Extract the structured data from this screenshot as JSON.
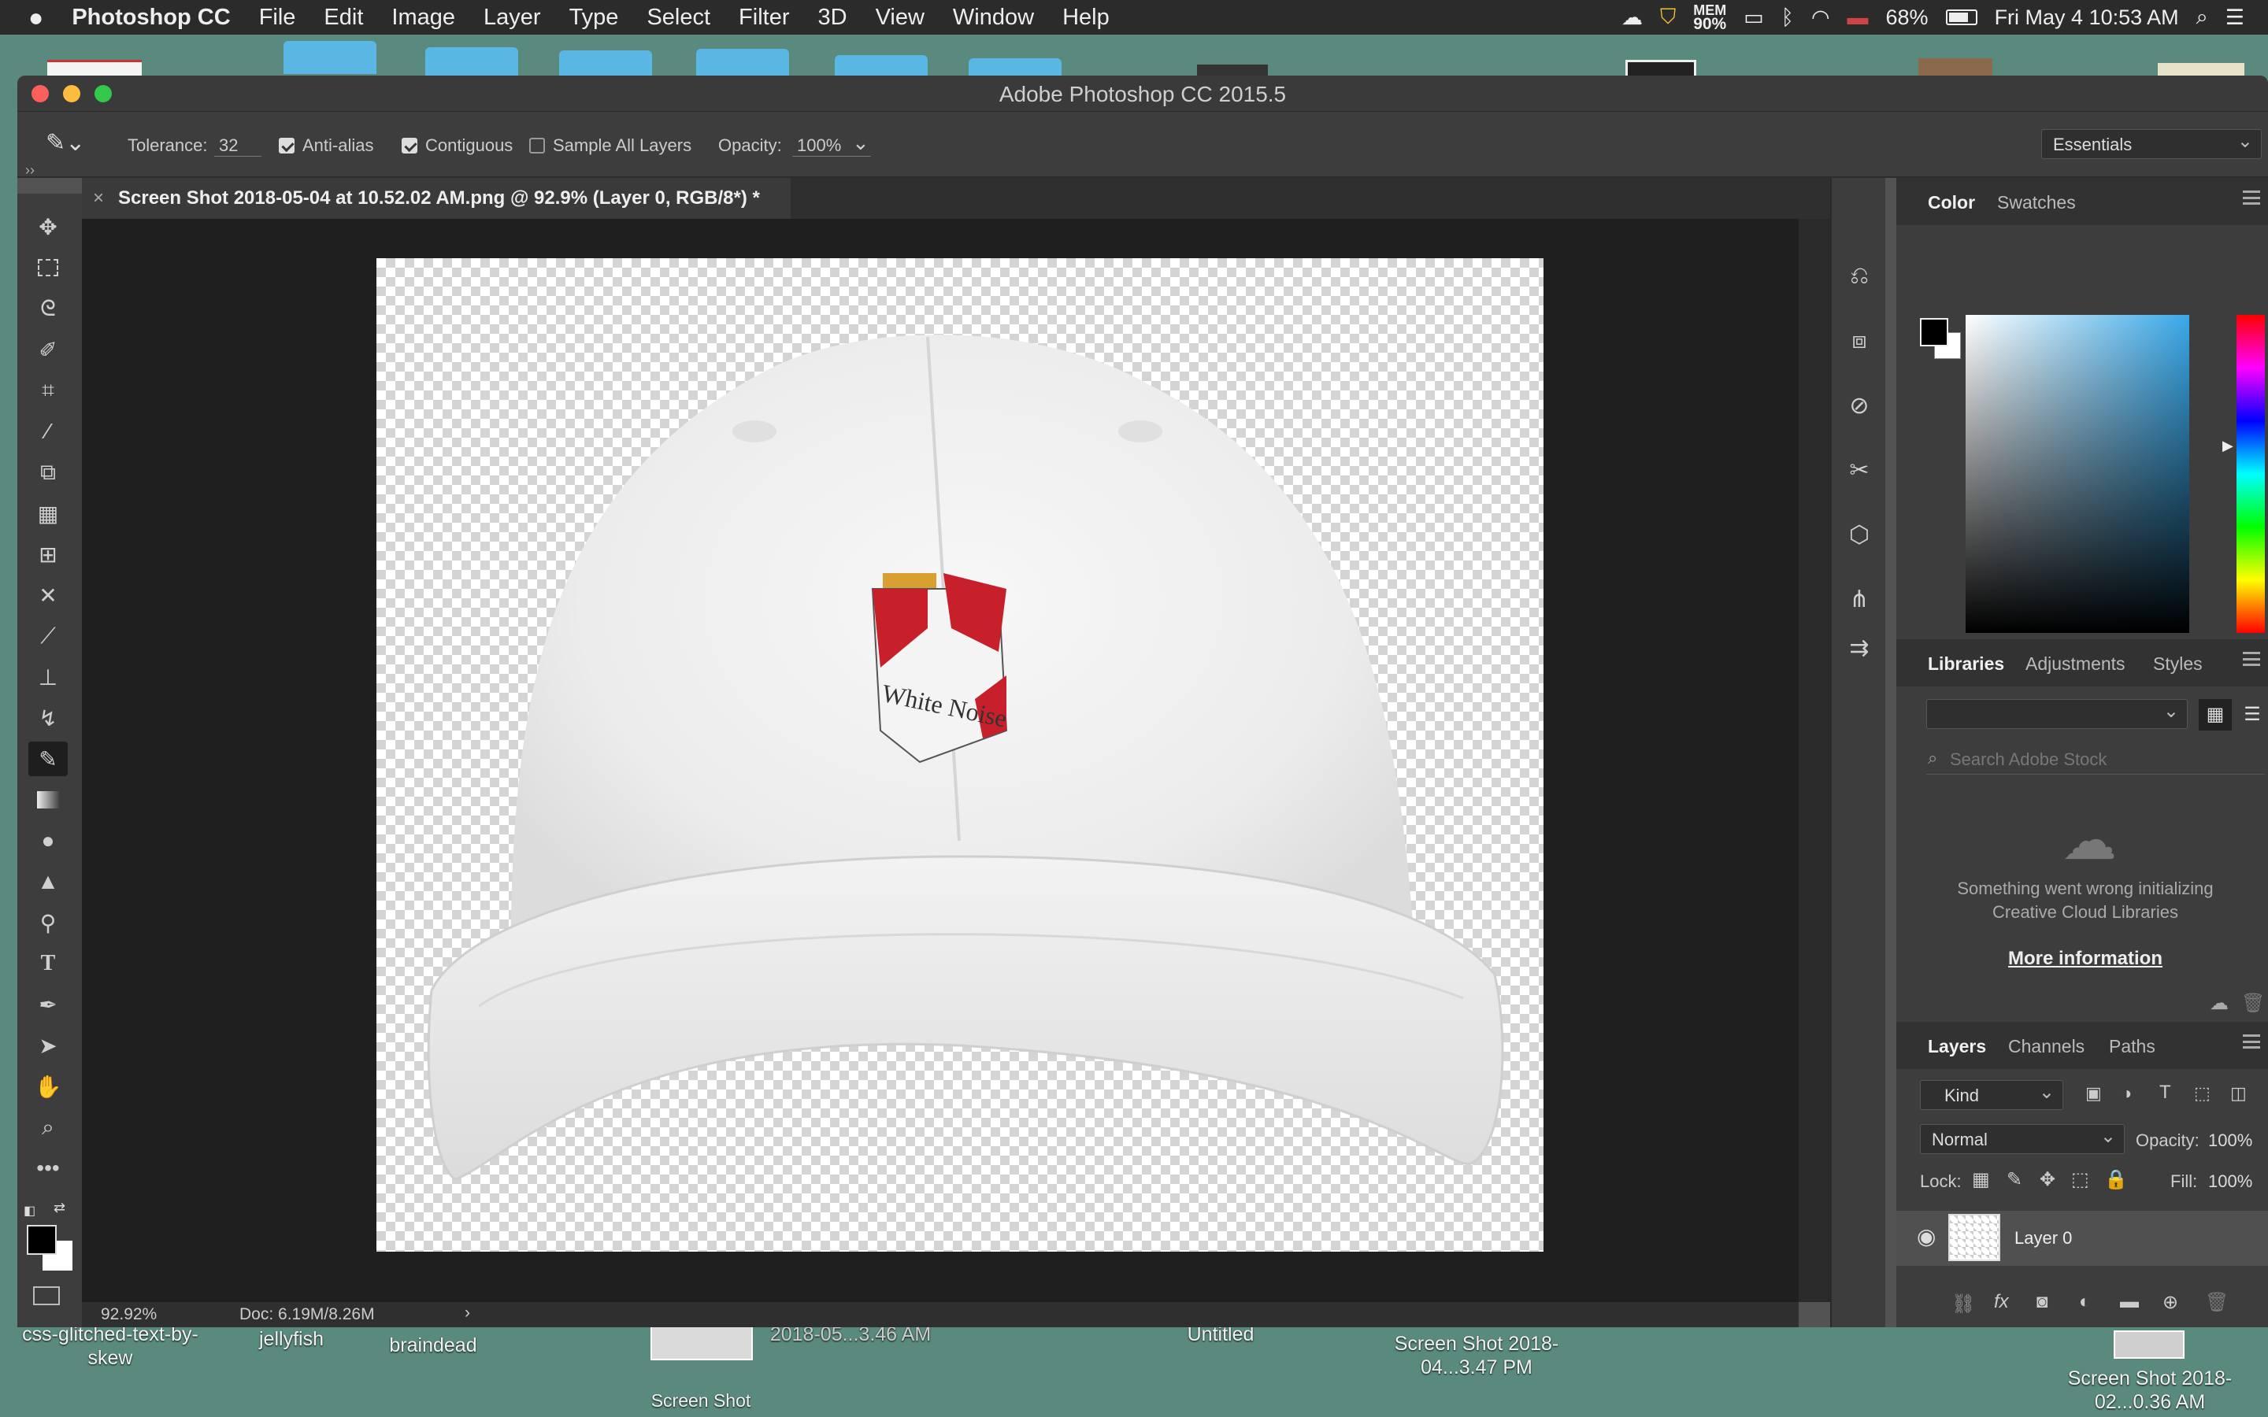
{
  "menubar": {
    "apple": "",
    "app": "Photoshop CC",
    "items": [
      "File",
      "Edit",
      "Image",
      "Layer",
      "Type",
      "Select",
      "Filter",
      "3D",
      "View",
      "Window",
      "Help"
    ],
    "mem_label": "MEM",
    "mem_value": "90%",
    "battery": "68%",
    "datetime": "Fri May 4  10:53 AM"
  },
  "desktop": {
    "labels": [
      "css-glitched-text-by-skew",
      "jellyfish",
      "braindead",
      "2018-05...3.46 AM",
      "Untitled",
      "Screen Shot 2018-04...3.47 PM",
      "Screen Shot 2018-02...0.36 AM",
      "Screen Shot"
    ]
  },
  "window": {
    "title": "Adobe Photoshop CC 2015.5"
  },
  "options": {
    "tolerance_label": "Tolerance:",
    "tolerance_value": "32",
    "antialias": "Anti-alias",
    "contiguous": "Contiguous",
    "sample_all": "Sample All Layers",
    "opacity_label": "Opacity:",
    "opacity_value": "100%",
    "workspace": "Essentials"
  },
  "document": {
    "tab_title": "Screen Shot 2018-05-04 at 10.52.02 AM.png @ 92.9% (Layer 0, RGB/8*) *",
    "zoom": "92.92%",
    "doc_size": "Doc: 6.19M/8.26M",
    "brand_text": "White Noise"
  },
  "color_panel": {
    "tabs": [
      "Color",
      "Swatches"
    ],
    "accent": "#3aa8e8"
  },
  "libraries_panel": {
    "tabs": [
      "Libraries",
      "Adjustments",
      "Styles"
    ],
    "search_placeholder": "Search Adobe Stock",
    "error": "Something went wrong initializing Creative Cloud Libraries",
    "more_info": "More information"
  },
  "layers_panel": {
    "tabs": [
      "Layers",
      "Channels",
      "Paths"
    ],
    "kind": "Kind",
    "blend": "Normal",
    "opacity_label": "Opacity:",
    "opacity_value": "100%",
    "lock_label": "Lock:",
    "fill_label": "Fill:",
    "fill_value": "100%",
    "layer_name": "Layer 0"
  }
}
